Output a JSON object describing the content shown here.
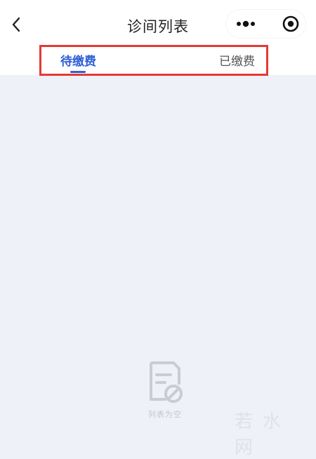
{
  "nav": {
    "title": "诊间列表",
    "back_icon": "chevron-left-icon",
    "more_icon": "more-dots-icon",
    "close_icon": "target-close-icon"
  },
  "tabs": [
    {
      "label": "待缴费",
      "active": true
    },
    {
      "label": "已缴费",
      "active": false
    }
  ],
  "colors": {
    "accent": "#2e5fd6",
    "highlight": "#e53935",
    "background": "#eef1f8"
  },
  "empty_state": {
    "icon": "document-empty-icon",
    "text": "列表为空"
  },
  "watermark": {
    "text": "若水网"
  }
}
